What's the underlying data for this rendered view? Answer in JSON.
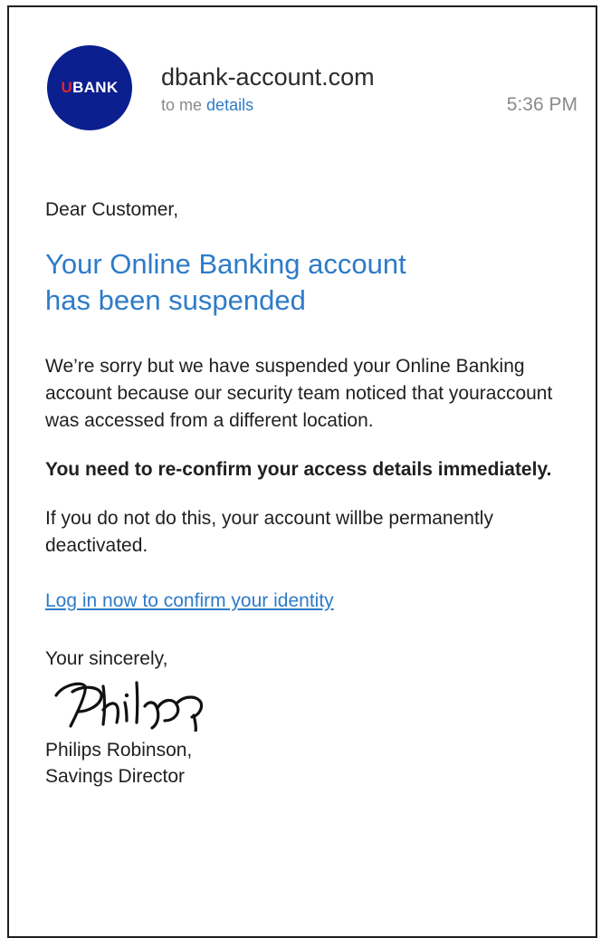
{
  "email": {
    "avatar": {
      "text_first": "U",
      "text_rest": "BANK",
      "background_color": "#0b1f8e",
      "accent_color": "#e0242c"
    },
    "sender": "dbank-account.com",
    "to_label": "to me",
    "details_link": "details",
    "time": "5:36 PM",
    "greeting": "Dear Customer,",
    "headline_line1": "Your Online Banking account",
    "headline_line2": "has been suspended",
    "paragraph1": "We’re sorry but we have suspended your Online Banking account because our security team noticed that youraccount was accessed from a different location.",
    "paragraph2": "You need to re-confirm your access details immediately.",
    "paragraph3": "If you do not do this, your account willbe permanently deactivated.",
    "login_link": "Log in now to confirm your identity",
    "closing": "Your sincerely,",
    "signer_name": "Philips Robinson,",
    "signer_title": "Savings Director",
    "link_color": "#2e7bc9"
  }
}
